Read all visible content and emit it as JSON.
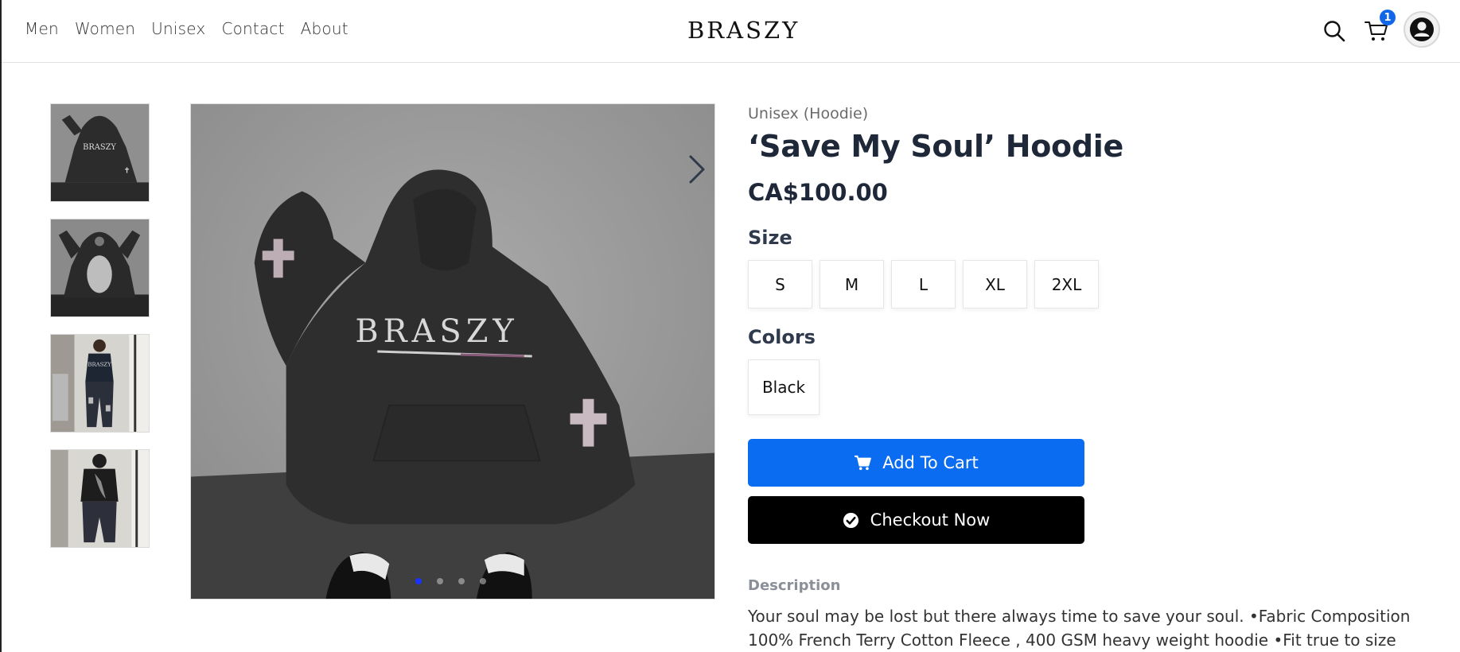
{
  "nav": {
    "items": [
      "Men",
      "Women",
      "Unisex",
      "Contact",
      "About"
    ]
  },
  "brand": {
    "logo_text": "BRASZY"
  },
  "header": {
    "icons": [
      "search-icon",
      "cart-icon",
      "avatar-icon"
    ],
    "cart_count": "1",
    "badge_color": "#1167e8"
  },
  "gallery": {
    "thumbnails": [
      "hoodie-front-flat",
      "hoodie-back-flat",
      "model-front",
      "model-back"
    ],
    "active_slide": 1,
    "slide_count": 4,
    "main_image_print": "BRASZY"
  },
  "product": {
    "category": "Unisex (Hoodie)",
    "title": "‘Save My Soul’ Hoodie",
    "price": "CA$100.00",
    "size_label": "Size",
    "sizes": [
      "S",
      "M",
      "L",
      "XL",
      "2XL"
    ],
    "colors_label": "Colors",
    "colors": [
      "Black"
    ],
    "add_to_cart_label": "Add To Cart",
    "checkout_label": "Checkout Now",
    "accent_color": "#0a6cf0",
    "description_label": "Description",
    "description": "Your soul may be lost but there always time to save your soul. •Fabric Composition 100% French Terry Cotton Fleece , 400 GSM heavy weight hoodie •Fit true to size •Care"
  }
}
